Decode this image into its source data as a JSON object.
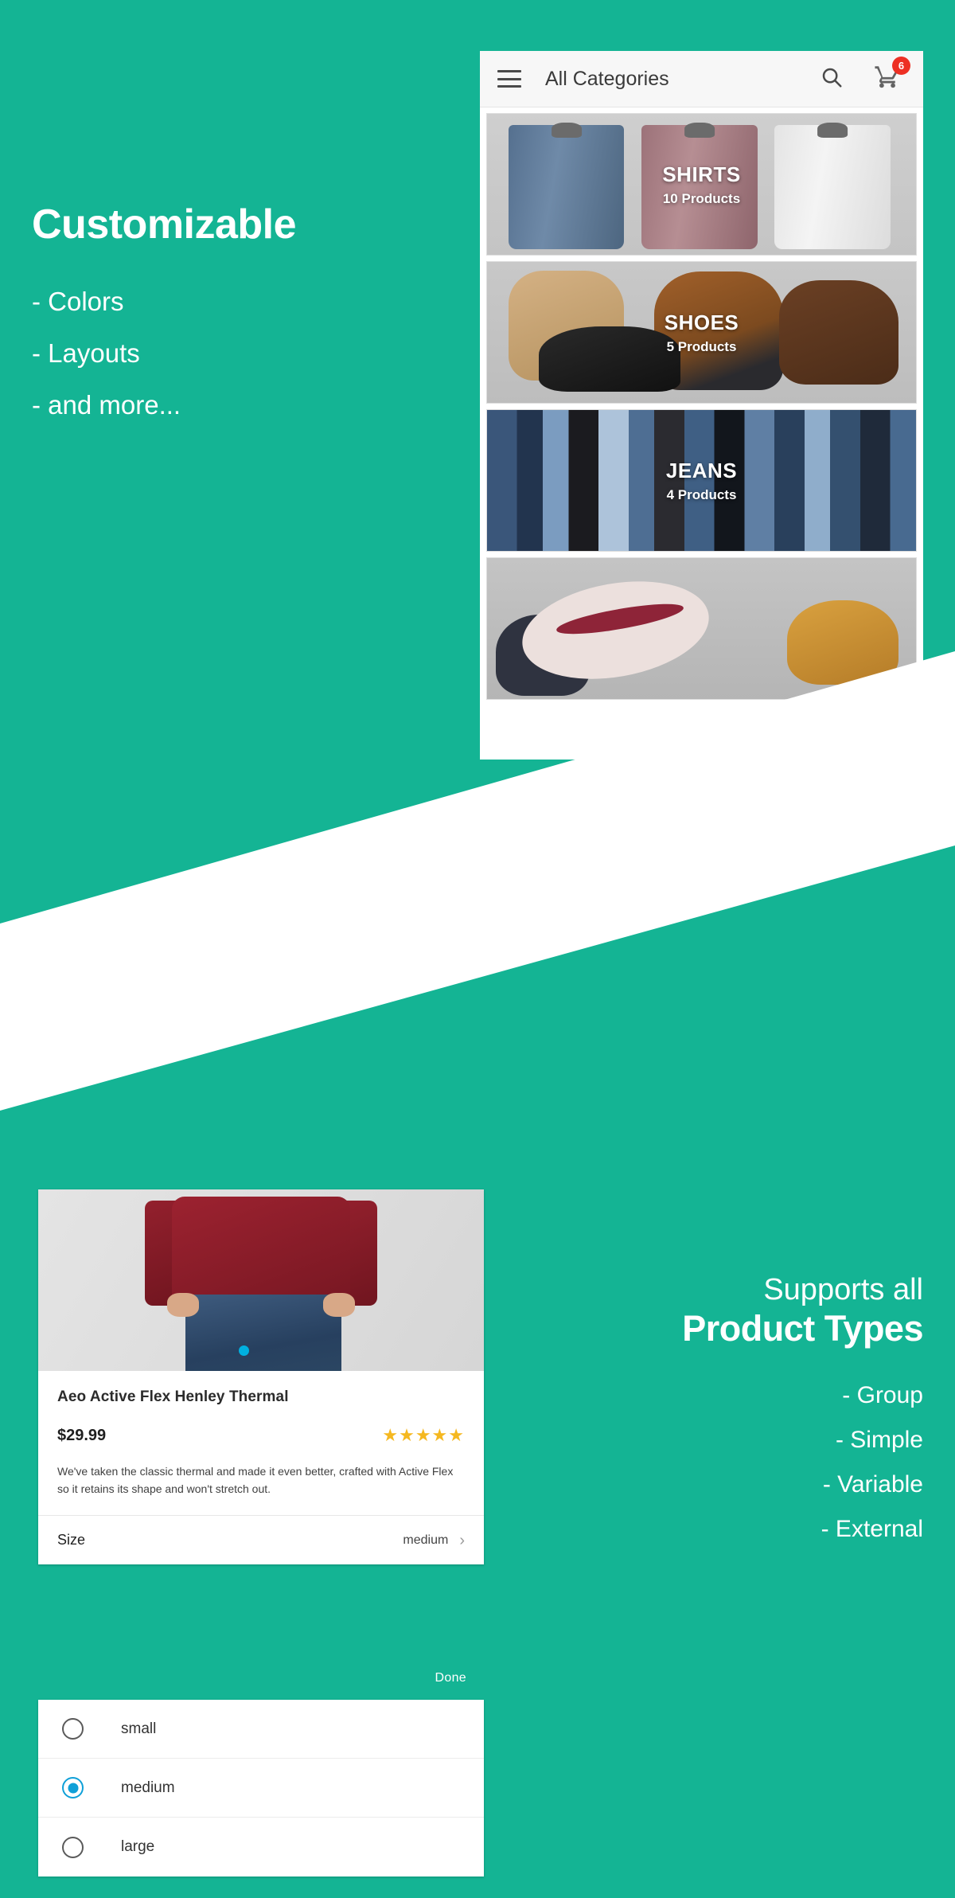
{
  "theme": {
    "brand_teal": "#14b494",
    "band_white": "#ffffff",
    "badge_red": "#ed3024",
    "star_gold": "#f5b820",
    "radio_blue": "#0fa0d8"
  },
  "section_customizable": {
    "headline": "Customizable",
    "features": [
      "- Colors",
      "- Layouts",
      "- and more..."
    ]
  },
  "phone_categories": {
    "appbar": {
      "menu_icon": "hamburger-icon",
      "title": "All Categories",
      "search_icon": "search-icon",
      "cart_icon": "cart-icon",
      "cart_badge": "6"
    },
    "cards": [
      {
        "name": "SHIRTS",
        "count": "10 Products",
        "art": "shirts"
      },
      {
        "name": "SHOES",
        "count": "5 Products",
        "art": "shoes"
      },
      {
        "name": "JEANS",
        "count": "4 Products",
        "art": "jeans"
      },
      {
        "name": "",
        "count": "",
        "art": "hats"
      }
    ]
  },
  "section_product_types": {
    "supports_line": "Supports all",
    "title": "Product Types",
    "types": [
      "- Group",
      "- Simple",
      "- Variable",
      "- External"
    ]
  },
  "product_card": {
    "title": "Aeo Active Flex Henley Thermal",
    "price": "$29.99",
    "rating_stars": "★★★★★",
    "description": "We've taken the classic thermal and made it even better, crafted with Active Flex so it retains its shape and won't stretch out.",
    "size_label": "Size",
    "size_value": "medium",
    "chevron_icon": "chevron-right-icon"
  },
  "size_picker": {
    "done_label": "Done",
    "options": [
      {
        "label": "small",
        "selected": false
      },
      {
        "label": "medium",
        "selected": true
      },
      {
        "label": "large",
        "selected": false
      }
    ]
  }
}
